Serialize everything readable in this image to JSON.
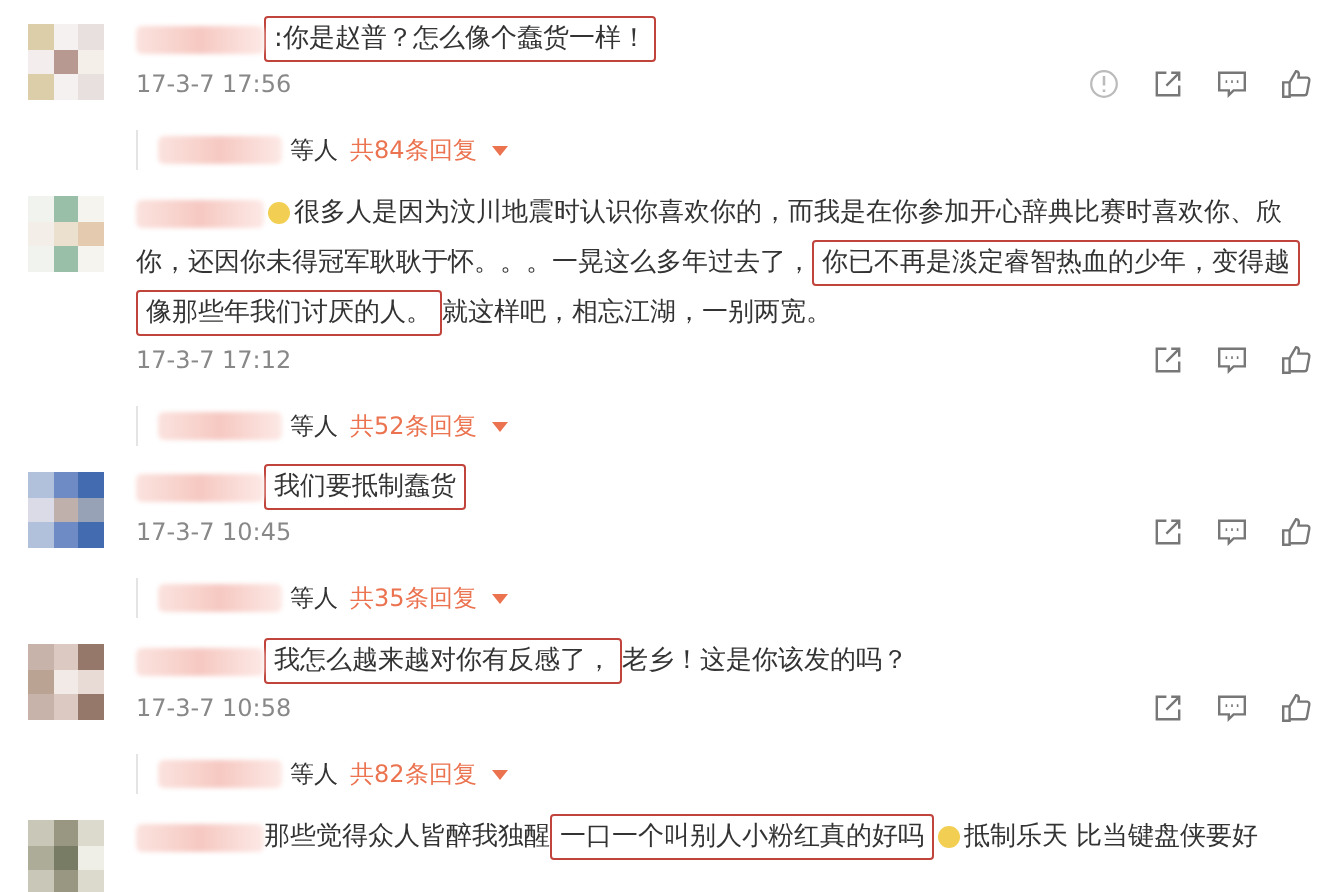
{
  "comments": [
    {
      "lines": [
        [
          {
            "text": ":你是赵普？怎么像个蠢货一样！",
            "marked": true
          }
        ]
      ],
      "emoji": false,
      "date": "17-3-7 17:56",
      "reportable": true,
      "replies": {
        "suffix": "等人",
        "count": "共84条回复"
      }
    },
    {
      "lines": [
        [
          {
            "text": "很多人是因为汶川地震时认识你喜欢你的，而我是在你参加开心辞典比赛时喜欢你、欣",
            "marked": false
          }
        ],
        [
          {
            "text": "你，还因你未得冠军耿耿于怀。。。一晃这么多年过去了，",
            "marked": false
          },
          {
            "text": "你已不再是淡定睿智热血的少年，变得越",
            "marked": true
          }
        ],
        [
          {
            "text": "像那些年我们讨厌的人。",
            "marked": true
          },
          {
            "text": "就这样吧，相忘江湖，一别两宽。",
            "marked": false
          }
        ]
      ],
      "emoji": true,
      "date": "17-3-7 17:12",
      "reportable": false,
      "replies": {
        "suffix": "等人",
        "count": "共52条回复"
      }
    },
    {
      "lines": [
        [
          {
            "text": "我们要抵制蠢货",
            "marked": true
          }
        ]
      ],
      "emoji": false,
      "date": "17-3-7 10:45",
      "reportable": false,
      "replies": {
        "suffix": "等人",
        "count": "共35条回复"
      }
    },
    {
      "lines": [
        [
          {
            "text": "我怎么越来越对你有反感了，",
            "marked": true
          },
          {
            "text": "老乡！这是你该发的吗？",
            "marked": false
          }
        ]
      ],
      "emoji": false,
      "date": "17-3-7 10:58",
      "reportable": false,
      "replies": {
        "suffix": "等人",
        "count": "共82条回复"
      }
    },
    {
      "lines": [
        [
          {
            "text": "那些觉得众人皆醉我独醒",
            "marked": false
          },
          {
            "text": "一口一个叫别人小粉红真的好吗",
            "marked": true,
            "emoji": true
          },
          {
            "text": "抵制乐天 比当键盘侠要好",
            "marked": false
          }
        ]
      ],
      "emoji": false
    }
  ]
}
